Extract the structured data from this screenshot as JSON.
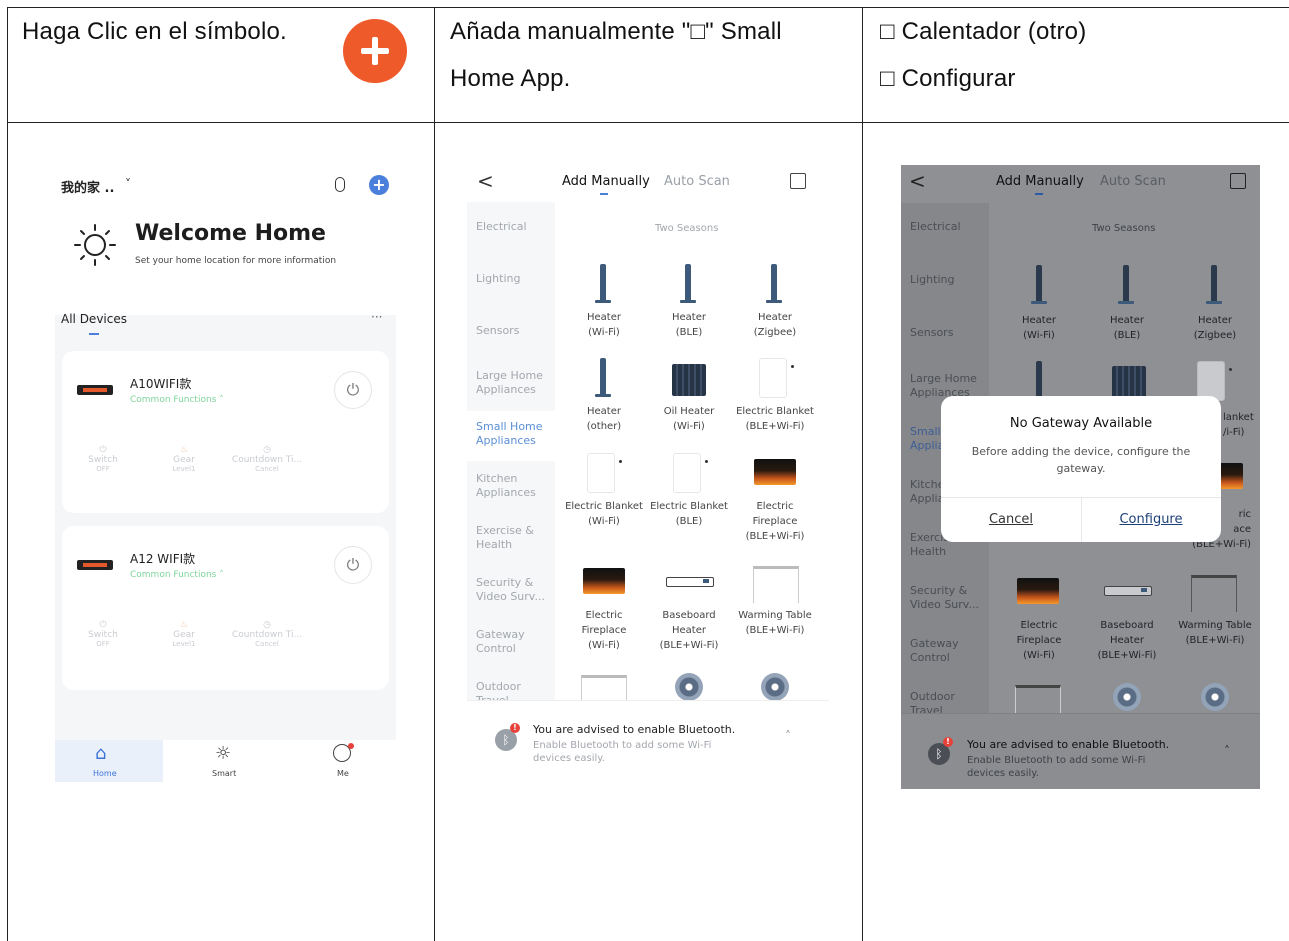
{
  "header": {
    "col1_text": "Haga Clic en el símbolo.",
    "col2_line1": "Añada manualmente \"□\" Small",
    "col2_line2": "Home App.",
    "col3_line1": "□ Calentador (otro)",
    "col3_line2": "□ Configurar"
  },
  "phone1": {
    "home_name": "我的家 ..",
    "chevron": "˅",
    "mic_icon": "🎙",
    "welcome_title": "Welcome Home",
    "welcome_sub": "Set your home location for more information",
    "all_devices": "All Devices",
    "more": "···",
    "devices": [
      {
        "name": "A10WIFI款",
        "sub": "Common Functions ˄",
        "switch": "Switch",
        "switch_state": "OFF",
        "gear": "Gear",
        "gear_state": "Level1",
        "countdown": "Countdown Ti...",
        "countdown_state": "Cancel"
      },
      {
        "name": "A12 WIFI款",
        "sub": "Common Functions ˄",
        "switch": "Switch",
        "switch_state": "OFF",
        "gear": "Gear",
        "gear_state": "Level1",
        "countdown": "Countdown Ti...",
        "countdown_state": "Cancel"
      }
    ],
    "nav": {
      "home": "Home",
      "smart": "Smart",
      "me": "Me"
    }
  },
  "phone2": {
    "back": "<",
    "tab_manual": "Add Manually",
    "tab_scan": "Auto Scan",
    "sidebar": [
      "Electrical",
      "Lighting",
      "Sensors",
      "Large Home Appliances",
      "Small Home Appliances",
      "Kitchen Appliances",
      "Exercise & Health",
      "Security & Video Surv...",
      "Gateway Control",
      "Outdoor Travel"
    ],
    "section": "Two Seasons",
    "tiles": [
      {
        "l1": "Heater",
        "l2": "(Wi-Fi)"
      },
      {
        "l1": "Heater",
        "l2": "(BLE)"
      },
      {
        "l1": "Heater",
        "l2": "(Zigbee)"
      },
      {
        "l1": "Heater",
        "l2": "(other)"
      },
      {
        "l1": "Oil Heater",
        "l2": "(Wi-Fi)"
      },
      {
        "l1": "Electric Blanket",
        "l2": "(BLE+Wi-Fi)"
      },
      {
        "l1": "Electric Blanket",
        "l2": "(Wi-Fi)"
      },
      {
        "l1": "Electric Blanket",
        "l2": "(BLE)"
      },
      {
        "l1": "Electric",
        "l2": "Fireplace",
        "l3": "(BLE+Wi-Fi)"
      },
      {
        "l1": "Electric",
        "l2": "Fireplace",
        "l3": "(Wi-Fi)"
      },
      {
        "l1": "Baseboard",
        "l2": "Heater",
        "l3": "(BLE+Wi-Fi)"
      },
      {
        "l1": "Warming Table",
        "l2": "(BLE+Wi-Fi)"
      }
    ],
    "bt_title": "You are advised to enable Bluetooth.",
    "bt_sub1": "Enable Bluetooth to add some Wi-Fi",
    "bt_sub2": "devices easily.",
    "bt_chevron": "˄"
  },
  "phone3": {
    "back": "<",
    "tab_manual": "Add Manually",
    "tab_scan": "Auto Scan",
    "sidebar": [
      "Electrical",
      "Lighting",
      "Sensors",
      "Large Home Appliances",
      "Small Applia",
      "Kitche Applia",
      "Exercis & Health",
      "Security & Video Surv...",
      "Gateway Control",
      "Outdoor Travel"
    ],
    "section": "Two Seasons",
    "tiles": [
      {
        "l1": "Heater",
        "l2": "(Wi-Fi)"
      },
      {
        "l1": "Heater",
        "l2": "(BLE)"
      },
      {
        "l1": "Heater",
        "l2": "(Zigbee)"
      },
      {
        "l1": "Electric",
        "l2": "Fireplace",
        "l3": "(Wi-Fi)"
      },
      {
        "l1": "Baseboard",
        "l2": "Heater",
        "l3": "(BLE+Wi-Fi)"
      },
      {
        "l1": "Warming Table",
        "l2": "(BLE+Wi-Fi)"
      }
    ],
    "peek": {
      "blanket_r1": "lanket",
      "blanket_r2": "/i-Fi)",
      "fire_r1": "ric",
      "fire_r2": "ace",
      "fire_r3": "(BLE+Wi-Fi)"
    },
    "dialog": {
      "title": "No Gateway Available",
      "body1": "Before adding the device, configure the",
      "body2": "gateway.",
      "cancel": "Cancel",
      "configure": "Configure"
    },
    "bt_title": "You are advised to enable Bluetooth.",
    "bt_sub1": "Enable Bluetooth to add some Wi-Fi",
    "bt_sub2": "devices easily.",
    "bt_chevron": "˄"
  }
}
